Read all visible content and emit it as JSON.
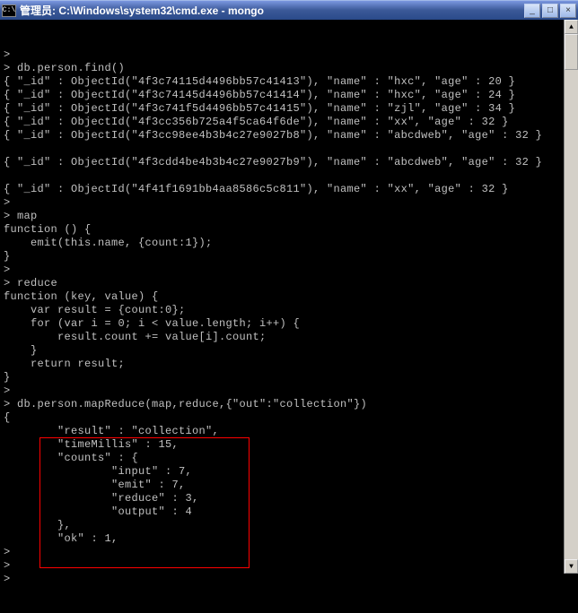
{
  "titlebar": {
    "icon_label": "C:\\",
    "title": "管理员: C:\\Windows\\system32\\cmd.exe - mongo",
    "min": "_",
    "max": "□",
    "close": "×"
  },
  "scrollbar": {
    "up": "▲",
    "down": "▼"
  },
  "terminal": {
    "lines": [
      ">",
      "> db.person.find()",
      "{ \"_id\" : ObjectId(\"4f3c74115d4496bb57c41413\"), \"name\" : \"hxc\", \"age\" : 20 }",
      "{ \"_id\" : ObjectId(\"4f3c74145d4496bb57c41414\"), \"name\" : \"hxc\", \"age\" : 24 }",
      "{ \"_id\" : ObjectId(\"4f3c741f5d4496bb57c41415\"), \"name\" : \"zjl\", \"age\" : 34 }",
      "{ \"_id\" : ObjectId(\"4f3cc356b725a4f5ca64f6de\"), \"name\" : \"xx\", \"age\" : 32 }",
      "{ \"_id\" : ObjectId(\"4f3cc98ee4b3b4c27e9027b8\"), \"name\" : \"abcdweb\", \"age\" : 32 }",
      "",
      "{ \"_id\" : ObjectId(\"4f3cdd4be4b3b4c27e9027b9\"), \"name\" : \"abcdweb\", \"age\" : 32 }",
      "",
      "{ \"_id\" : ObjectId(\"4f41f1691bb4aa8586c5c811\"), \"name\" : \"xx\", \"age\" : 32 }",
      ">",
      "> map",
      "function () {",
      "    emit(this.name, {count:1});",
      "}",
      ">",
      "> reduce",
      "function (key, value) {",
      "    var result = {count:0};",
      "    for (var i = 0; i < value.length; i++) {",
      "        result.count += value[i].count;",
      "    }",
      "    return result;",
      "}",
      ">",
      "> db.person.mapReduce(map,reduce,{\"out\":\"collection\"})",
      "{",
      "        \"result\" : \"collection\",",
      "        \"timeMillis\" : 15,",
      "        \"counts\" : {",
      "                \"input\" : 7,",
      "                \"emit\" : 7,",
      "                \"reduce\" : 3,",
      "                \"output\" : 4",
      "        },",
      "        \"ok\" : 1,",
      ">",
      ">",
      ">"
    ]
  }
}
